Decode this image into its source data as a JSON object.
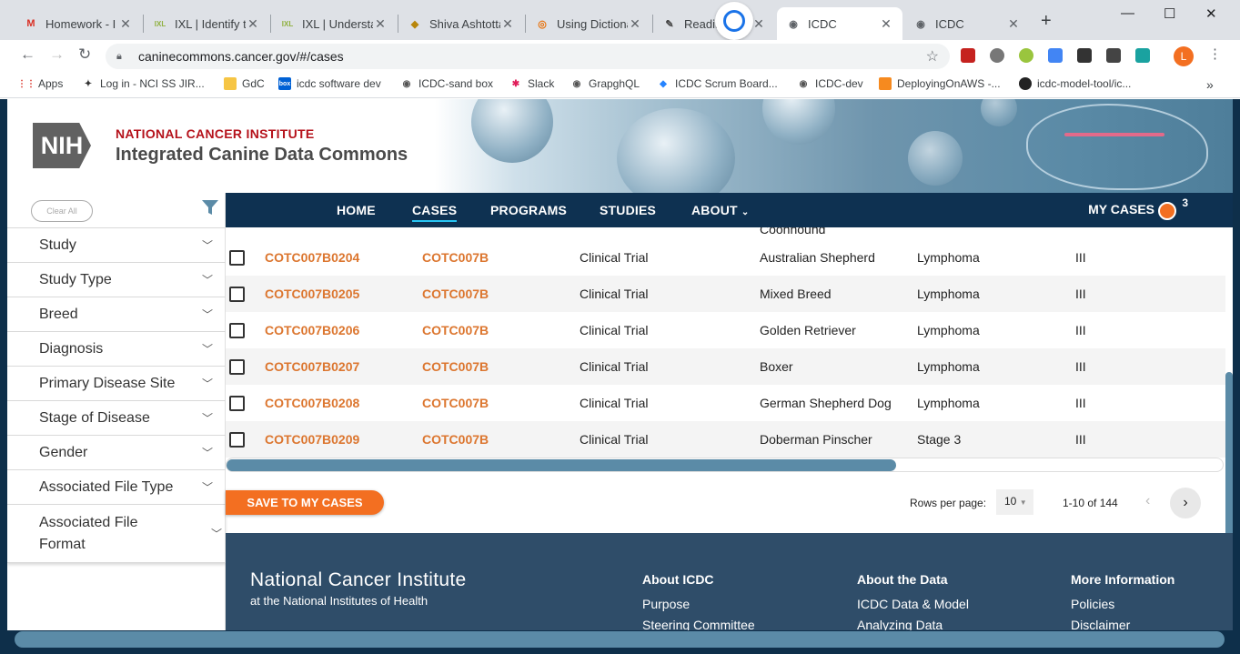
{
  "browser": {
    "tabs": [
      {
        "title": "Homework - I",
        "icon": "gmail-icon",
        "fav": "M",
        "color": "#d93025"
      },
      {
        "title": "IXL | Identify t",
        "icon": "ixl-icon",
        "fav": "IXL",
        "color": "#8fb03f"
      },
      {
        "title": "IXL | Understa",
        "icon": "ixl-icon",
        "fav": "IXL",
        "color": "#8fb03f"
      },
      {
        "title": "Shiva Ashtotta",
        "icon": "deity-icon",
        "fav": "◆",
        "color": "#b8860b"
      },
      {
        "title": "Using Dictiona",
        "icon": "dictionary-icon",
        "fav": "◎",
        "color": "#e8710a"
      },
      {
        "title": "Readin",
        "icon": "reading-icon",
        "fav": "✎",
        "color": "#444"
      },
      {
        "title": "ICDC",
        "icon": "globe-icon",
        "fav": "◉",
        "color": "#5f6368"
      },
      {
        "title": "ICDC",
        "icon": "globe-icon",
        "fav": "◉",
        "color": "#5f6368"
      }
    ],
    "url": "caninecommons.cancer.gov/#/cases",
    "bookmarks": [
      {
        "label": "Apps",
        "icon": "apps-grid-icon"
      },
      {
        "label": "Log in - NCI SS JIR...",
        "icon": "jira-icon"
      },
      {
        "label": "GdC",
        "icon": "folder-icon"
      },
      {
        "label": "icdc software dev",
        "icon": "box-icon"
      },
      {
        "label": "ICDC-sand box",
        "icon": "globe-icon"
      },
      {
        "label": "Slack",
        "icon": "slack-icon"
      },
      {
        "label": "GrapghQL",
        "icon": "globe-icon"
      },
      {
        "label": "ICDC Scrum Board...",
        "icon": "jira-diamond-icon"
      },
      {
        "label": "ICDC-dev",
        "icon": "globe-icon"
      },
      {
        "label": "DeployingOnAWS -...",
        "icon": "aws-icon"
      },
      {
        "label": "icdc-model-tool/ic...",
        "icon": "github-icon"
      }
    ],
    "profile_initial": "L"
  },
  "header": {
    "logo_text": "NIH",
    "org": "NATIONAL CANCER INSTITUTE",
    "title": "Integrated Canine Data Commons"
  },
  "nav": {
    "items": [
      "HOME",
      "CASES",
      "PROGRAMS",
      "STUDIES",
      "ABOUT"
    ],
    "active": "CASES",
    "my_cases": "MY CASES",
    "my_cases_count": "3"
  },
  "sidebar": {
    "clear_all": "Clear All",
    "facets": [
      "Study",
      "Study Type",
      "Breed",
      "Diagnosis",
      "Primary Disease Site",
      "Stage of Disease",
      "Gender",
      "Associated File Type",
      "Associated File Format"
    ]
  },
  "table": {
    "partial_row_text": "Coonhound",
    "rows": [
      {
        "case_id": "COTC007B0204",
        "study": "COTC007B",
        "study_type": "Clinical Trial",
        "breed": "Australian Shepherd",
        "diagnosis": "Lymphoma",
        "stage": "III"
      },
      {
        "case_id": "COTC007B0205",
        "study": "COTC007B",
        "study_type": "Clinical Trial",
        "breed": "Mixed Breed",
        "diagnosis": "Lymphoma",
        "stage": "III"
      },
      {
        "case_id": "COTC007B0206",
        "study": "COTC007B",
        "study_type": "Clinical Trial",
        "breed": "Golden Retriever",
        "diagnosis": "Lymphoma",
        "stage": "III"
      },
      {
        "case_id": "COTC007B0207",
        "study": "COTC007B",
        "study_type": "Clinical Trial",
        "breed": "Boxer",
        "diagnosis": "Lymphoma",
        "stage": "III"
      },
      {
        "case_id": "COTC007B0208",
        "study": "COTC007B",
        "study_type": "Clinical Trial",
        "breed": "German Shepherd Dog",
        "diagnosis": "Lymphoma",
        "stage": "III"
      },
      {
        "case_id": "COTC007B0209",
        "study": "COTC007B",
        "study_type": "Clinical Trial",
        "breed": "Doberman Pinscher",
        "diagnosis": "Stage 3",
        "stage": "III"
      }
    ]
  },
  "controls": {
    "save_button": "SAVE TO MY CASES",
    "rows_per_page_label": "Rows per page:",
    "rows_per_page_value": "10",
    "range": "1-10 of 144"
  },
  "footer": {
    "org": "National Cancer Institute",
    "sub": "at the National Institutes of Health",
    "columns": [
      {
        "heading": "About ICDC",
        "links": [
          "Purpose",
          "Steering Committee"
        ]
      },
      {
        "heading": "About the Data",
        "links": [
          "ICDC Data & Model",
          "Analyzing Data"
        ]
      },
      {
        "heading": "More Information",
        "links": [
          "Policies",
          "Disclaimer"
        ]
      }
    ]
  },
  "colors": {
    "accent_orange": "#f36f21",
    "link_orange": "#dc762f",
    "nav_blue": "#0e3151",
    "footer_blue": "#2f4d69",
    "nci_red": "#b5121b"
  }
}
